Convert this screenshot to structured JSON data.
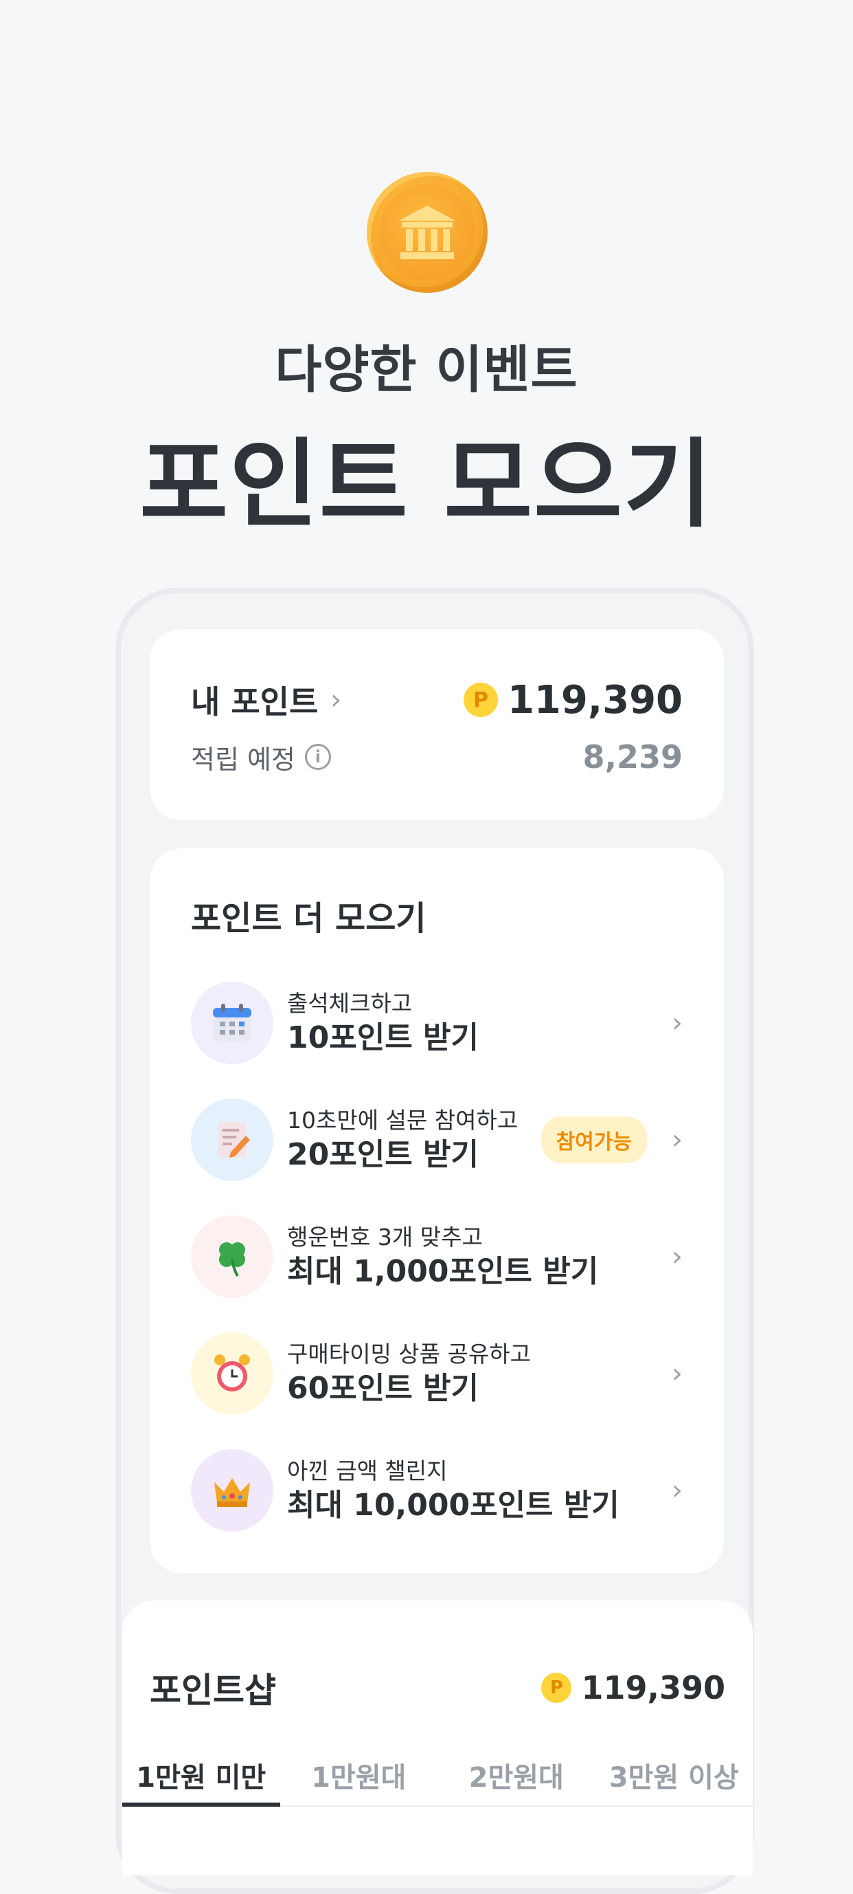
{
  "hero": {
    "subtitle": "다양한 이벤트",
    "title": "포인트 모으기",
    "icon": "bank-coin-icon"
  },
  "my_points": {
    "label": "내 포인트",
    "coin_symbol": "P",
    "amount": "119,390",
    "pending_label": "적립 예정",
    "pending_value": "8,239"
  },
  "more_points": {
    "title": "포인트 더 모으기",
    "events": [
      {
        "icon": "calendar-icon",
        "emoji": "📅",
        "bg": "#f0edfd",
        "sub": "출석체크하고",
        "main": "10포인트 받기",
        "badge": ""
      },
      {
        "icon": "memo-icon",
        "emoji": "📝",
        "bg": "#e4f1fd",
        "sub": "10초만에 설문 참여하고",
        "main": "20포인트 받기",
        "badge": "참여가능"
      },
      {
        "icon": "clover-icon",
        "emoji": "🍀",
        "bg": "#fdf0f0",
        "sub": "행운번호 3개 맞추고",
        "main": "최대 1,000포인트 받기",
        "badge": ""
      },
      {
        "icon": "alarm-clock-icon",
        "emoji": "⏰",
        "bg": "#fff8dc",
        "sub": "구매타이밍 상품 공유하고",
        "main": "60포인트 받기",
        "badge": ""
      },
      {
        "icon": "crown-icon",
        "emoji": "👑",
        "bg": "#f1e8fb",
        "sub": "아낀 금액 챌린지",
        "main": "최대 10,000포인트 받기",
        "badge": ""
      }
    ]
  },
  "shop": {
    "title": "포인트샵",
    "coin_symbol": "P",
    "amount": "119,390",
    "tabs": [
      "1만원 미만",
      "1만원대",
      "2만원대",
      "3만원 이상"
    ],
    "active_tab": "1만원 미만"
  }
}
